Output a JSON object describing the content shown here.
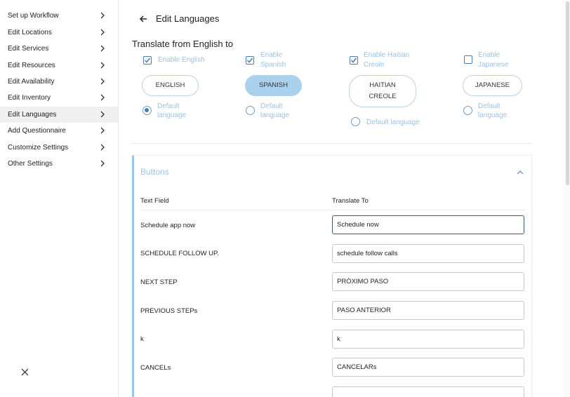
{
  "sidebar": {
    "items": [
      {
        "label": "Set up Workflow"
      },
      {
        "label": "Edit Locations"
      },
      {
        "label": "Edit Services"
      },
      {
        "label": "Edit Resources"
      },
      {
        "label": "Edit Availability"
      },
      {
        "label": "Edit Inventory"
      },
      {
        "label": "Edit Languages",
        "active": true
      },
      {
        "label": "Add Questionnaire"
      },
      {
        "label": "Customize Settings"
      },
      {
        "label": "Other Settings"
      }
    ]
  },
  "header": {
    "title": "Edit Languages"
  },
  "translate": {
    "heading": "Translate from English to",
    "languages": [
      {
        "enable_label": "Enable English",
        "enabled": true,
        "pill": "ENGLISH",
        "selected": false,
        "default_label": "Default language",
        "is_default": true
      },
      {
        "enable_label": "Enable Spanish",
        "enabled": true,
        "pill": "SPANISH",
        "selected": true,
        "default_label": "Default language",
        "is_default": false
      },
      {
        "enable_label": "Enable Haitian Creole",
        "enabled": true,
        "pill": "HAITIAN CREOLE",
        "selected": false,
        "default_label": "Default language",
        "is_default": false
      },
      {
        "enable_label": "Enable Japanese",
        "enabled": false,
        "pill": "JAPANESE",
        "selected": false,
        "default_label": "Default language",
        "is_default": false
      }
    ]
  },
  "buttons_section": {
    "title": "Buttons",
    "col_text_field": "Text Field",
    "col_translate_to": "Translate To",
    "rows": [
      {
        "label": "Schedule app now",
        "value": "Schedule now"
      },
      {
        "label": "SCHEDULE FOLLOW UP.",
        "value": "schedule follow calls"
      },
      {
        "label": "NEXT STEP",
        "value": "PRÓXIMO PASO"
      },
      {
        "label": "PREVIOUS STEPs",
        "value": "PASO ANTERIOR"
      },
      {
        "label": "k",
        "value": "k"
      },
      {
        "label": "CANCELs",
        "value": "CANCELARs"
      }
    ]
  },
  "colors": {
    "accent": "#4a7bb7",
    "pill_selected": "#a9d0ec",
    "muted_label": "#9cc2e5",
    "card_border": "#9cc7e8"
  }
}
